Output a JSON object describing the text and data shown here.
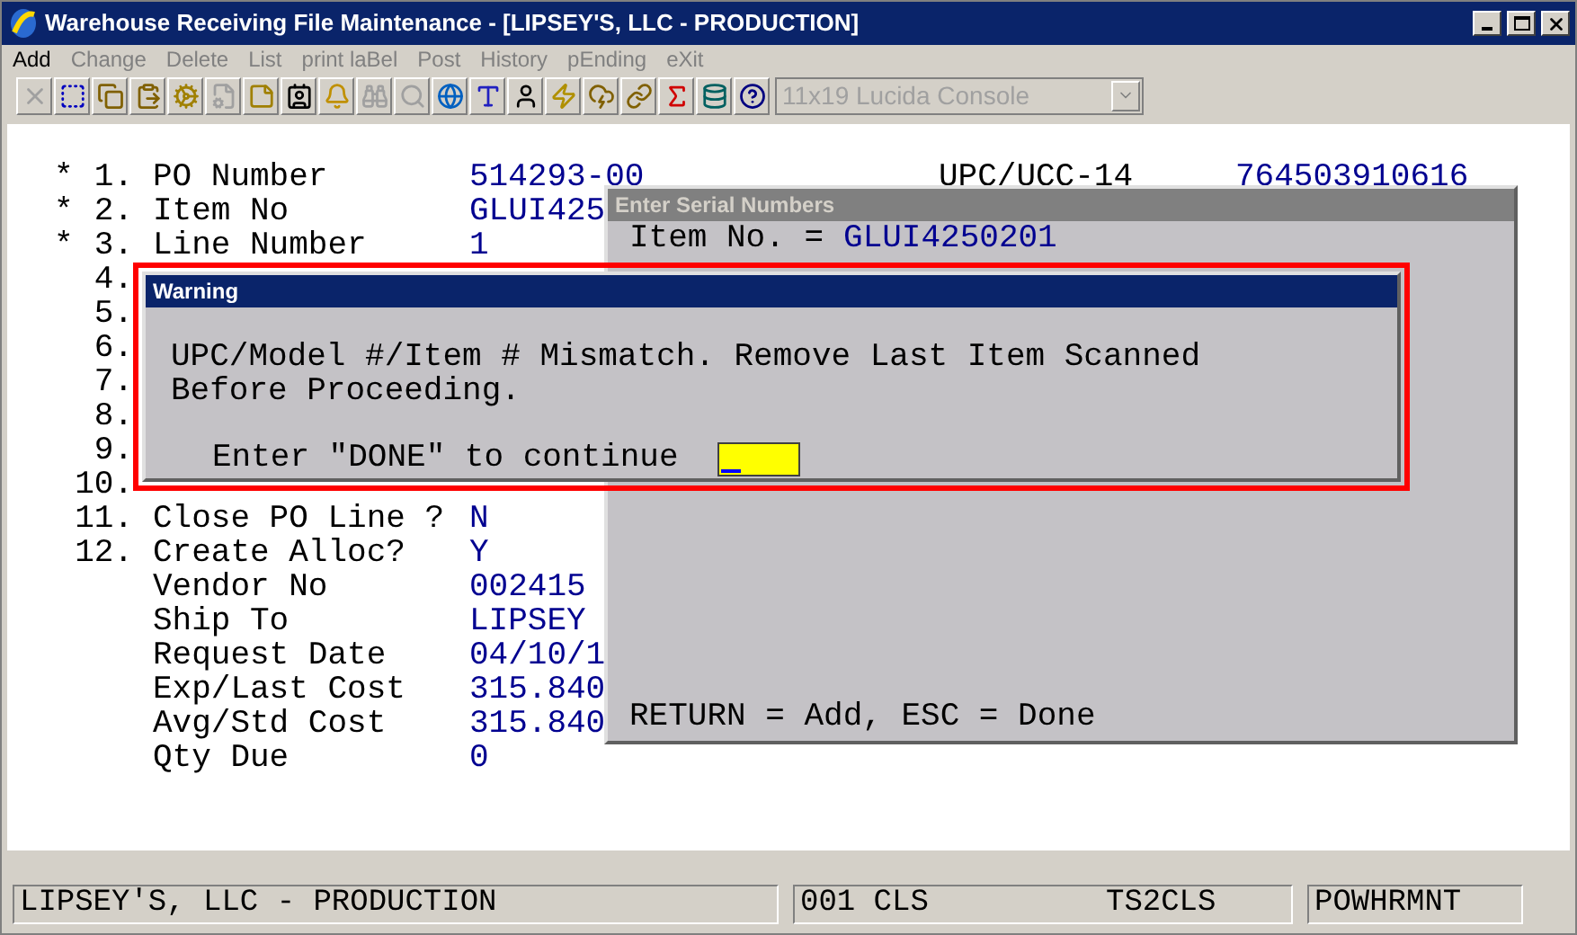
{
  "window": {
    "title": "Warehouse Receiving File Maintenance - [LIPSEY'S, LLC - PRODUCTION]"
  },
  "menu": [
    {
      "label": "Add",
      "disabled": false
    },
    {
      "label": "Change",
      "disabled": true
    },
    {
      "label": "Delete",
      "disabled": true
    },
    {
      "label": "List",
      "disabled": true
    },
    {
      "label": "print laBel",
      "disabled": true
    },
    {
      "label": "Post",
      "disabled": true
    },
    {
      "label": "History",
      "disabled": true
    },
    {
      "label": "pEnding",
      "disabled": true
    },
    {
      "label": "eXit",
      "disabled": true
    }
  ],
  "toolbar": [
    {
      "disabled": true
    },
    {
      "disabled": false
    },
    {
      "disabled": false
    },
    {
      "disabled": false
    },
    {
      "disabled": false
    },
    {
      "disabled": true
    },
    {
      "disabled": false
    },
    {
      "disabled": false
    },
    {
      "disabled": false
    },
    {
      "disabled": true
    },
    {
      "disabled": true
    },
    {
      "disabled": false
    },
    {
      "disabled": false
    },
    {
      "disabled": false
    },
    {
      "disabled": false
    },
    {
      "disabled": false
    },
    {
      "disabled": false
    },
    {
      "disabled": false
    },
    {
      "disabled": false
    },
    {
      "disabled": false
    }
  ],
  "font_select": {
    "value": "11x19 Lucida Console",
    "disabled": true
  },
  "fields": [
    {
      "mark": "*",
      "number": "1.",
      "label": "PO Number",
      "value": "514293-00"
    },
    {
      "mark": "*",
      "number": "2.",
      "label": "Item No",
      "value": "GLUI425"
    },
    {
      "mark": "*",
      "number": "3.",
      "label": "Line Number",
      "value": "1"
    },
    {
      "number": "4."
    },
    {
      "number": "5."
    },
    {
      "number": "6."
    },
    {
      "number": "7."
    },
    {
      "number": "8."
    },
    {
      "number": "9."
    },
    {
      "number": "10."
    },
    {
      "number": "11.",
      "label": "Close PO Line ?",
      "value": "N"
    },
    {
      "number": "12.",
      "label": "Create Alloc?",
      "value": "Y"
    },
    {
      "label": "Vendor No",
      "value": "002415"
    },
    {
      "label": "Ship To",
      "value": "LIPSEY"
    },
    {
      "label": "Request Date",
      "value": "04/10/1"
    },
    {
      "label": "Exp/Last Cost",
      "value": "315.840"
    },
    {
      "label": "Avg/Std Cost",
      "value": "315.840"
    },
    {
      "label": "Qty Due",
      "value": "0"
    }
  ],
  "upc": {
    "label": "UPC/UCC-14",
    "value": "764503910616"
  },
  "serial_dialog": {
    "title": "Enter Serial Numbers",
    "item_label": "Item No. =",
    "item_value": "GLUI4250201",
    "footer": "RETURN = Add, ESC = Done"
  },
  "warning_dialog": {
    "title": "Warning",
    "message_lines": [
      "UPC/Model #/Item # Mismatch. Remove Last Item Scanned",
      "Before Proceeding."
    ],
    "prompt": "Enter \"DONE\" to continue",
    "highlighted": true
  },
  "status_bar": [
    "LIPSEY'S, LLC - PRODUCTION",
    "001 CLS",
    "TS2CLS",
    "POWHRMNT"
  ]
}
